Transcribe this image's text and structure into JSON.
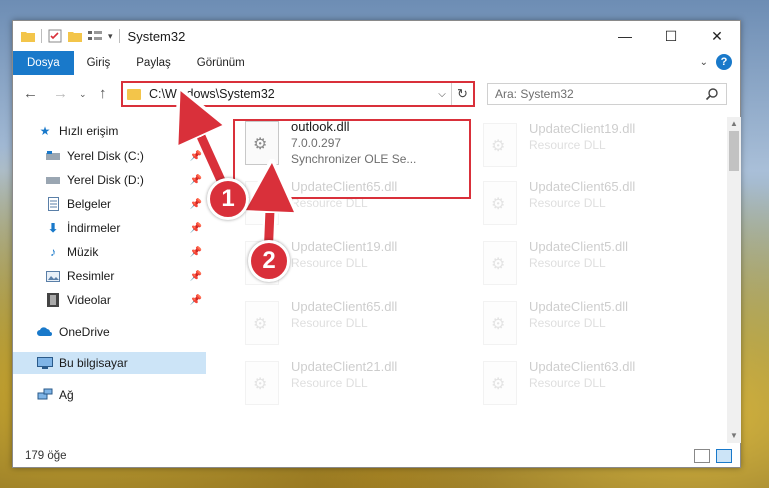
{
  "window": {
    "title": "System32"
  },
  "controls": {
    "minimize": "—",
    "maximize": "☐",
    "close": "✕"
  },
  "ribbon": {
    "tabs": [
      {
        "label": "Dosya",
        "active": true
      },
      {
        "label": "Giriş"
      },
      {
        "label": "Paylaş"
      },
      {
        "label": "Görünüm"
      }
    ]
  },
  "address": {
    "path": "C:\\Windows\\System32"
  },
  "search": {
    "placeholder": "Ara: System32"
  },
  "nav": [
    {
      "label": "Hızlı erişim",
      "icon": "star-icon",
      "pinned": false
    },
    {
      "label": "Yerel Disk (C:)",
      "icon": "drive-icon",
      "pinned": true
    },
    {
      "label": "Yerel Disk (D:)",
      "icon": "drive-icon",
      "pinned": true
    },
    {
      "label": "Belgeler",
      "icon": "documents-icon",
      "pinned": true
    },
    {
      "label": "İndirmeler",
      "icon": "download-icon",
      "pinned": true
    },
    {
      "label": "Müzik",
      "icon": "music-icon",
      "pinned": true
    },
    {
      "label": "Resimler",
      "icon": "pictures-icon",
      "pinned": true
    },
    {
      "label": "Videolar",
      "icon": "videos-icon",
      "pinned": true
    },
    {
      "label": "OneDrive",
      "icon": "cloud-icon",
      "pinned": false
    },
    {
      "label": "Bu bilgisayar",
      "icon": "computer-icon",
      "pinned": false,
      "selected": true
    },
    {
      "label": "Ağ",
      "icon": "network-icon",
      "pinned": false
    }
  ],
  "files": [
    {
      "name": "outlook.dll",
      "line2": "7.0.0.297",
      "line3": "Synchronizer OLE Se...",
      "highlight": true
    },
    {
      "name": "UpdateClient19.dll",
      "line2": "Resource DLL"
    },
    {
      "name": "UpdateClient65.dll",
      "line2": "Resource DLL"
    },
    {
      "name": "UpdateClient65.dll",
      "line2": "Resource DLL"
    },
    {
      "name": "UpdateClient19.dll",
      "line2": "Resource DLL"
    },
    {
      "name": "UpdateClient5.dll",
      "line2": "Resource DLL"
    },
    {
      "name": "UpdateClient65.dll",
      "line2": "Resource DLL"
    },
    {
      "name": "UpdateClient5.dll",
      "line2": "Resource DLL"
    },
    {
      "name": "UpdateClient21.dll",
      "line2": "Resource DLL"
    },
    {
      "name": "UpdateClient63.dll",
      "line2": "Resource DLL"
    }
  ],
  "status": {
    "count": "179 öğe"
  },
  "annotations": {
    "badge1": "1",
    "badge2": "2"
  },
  "colors": {
    "accent": "#1979ca",
    "annotation": "#d9303a",
    "selected": "#cce4f7"
  }
}
